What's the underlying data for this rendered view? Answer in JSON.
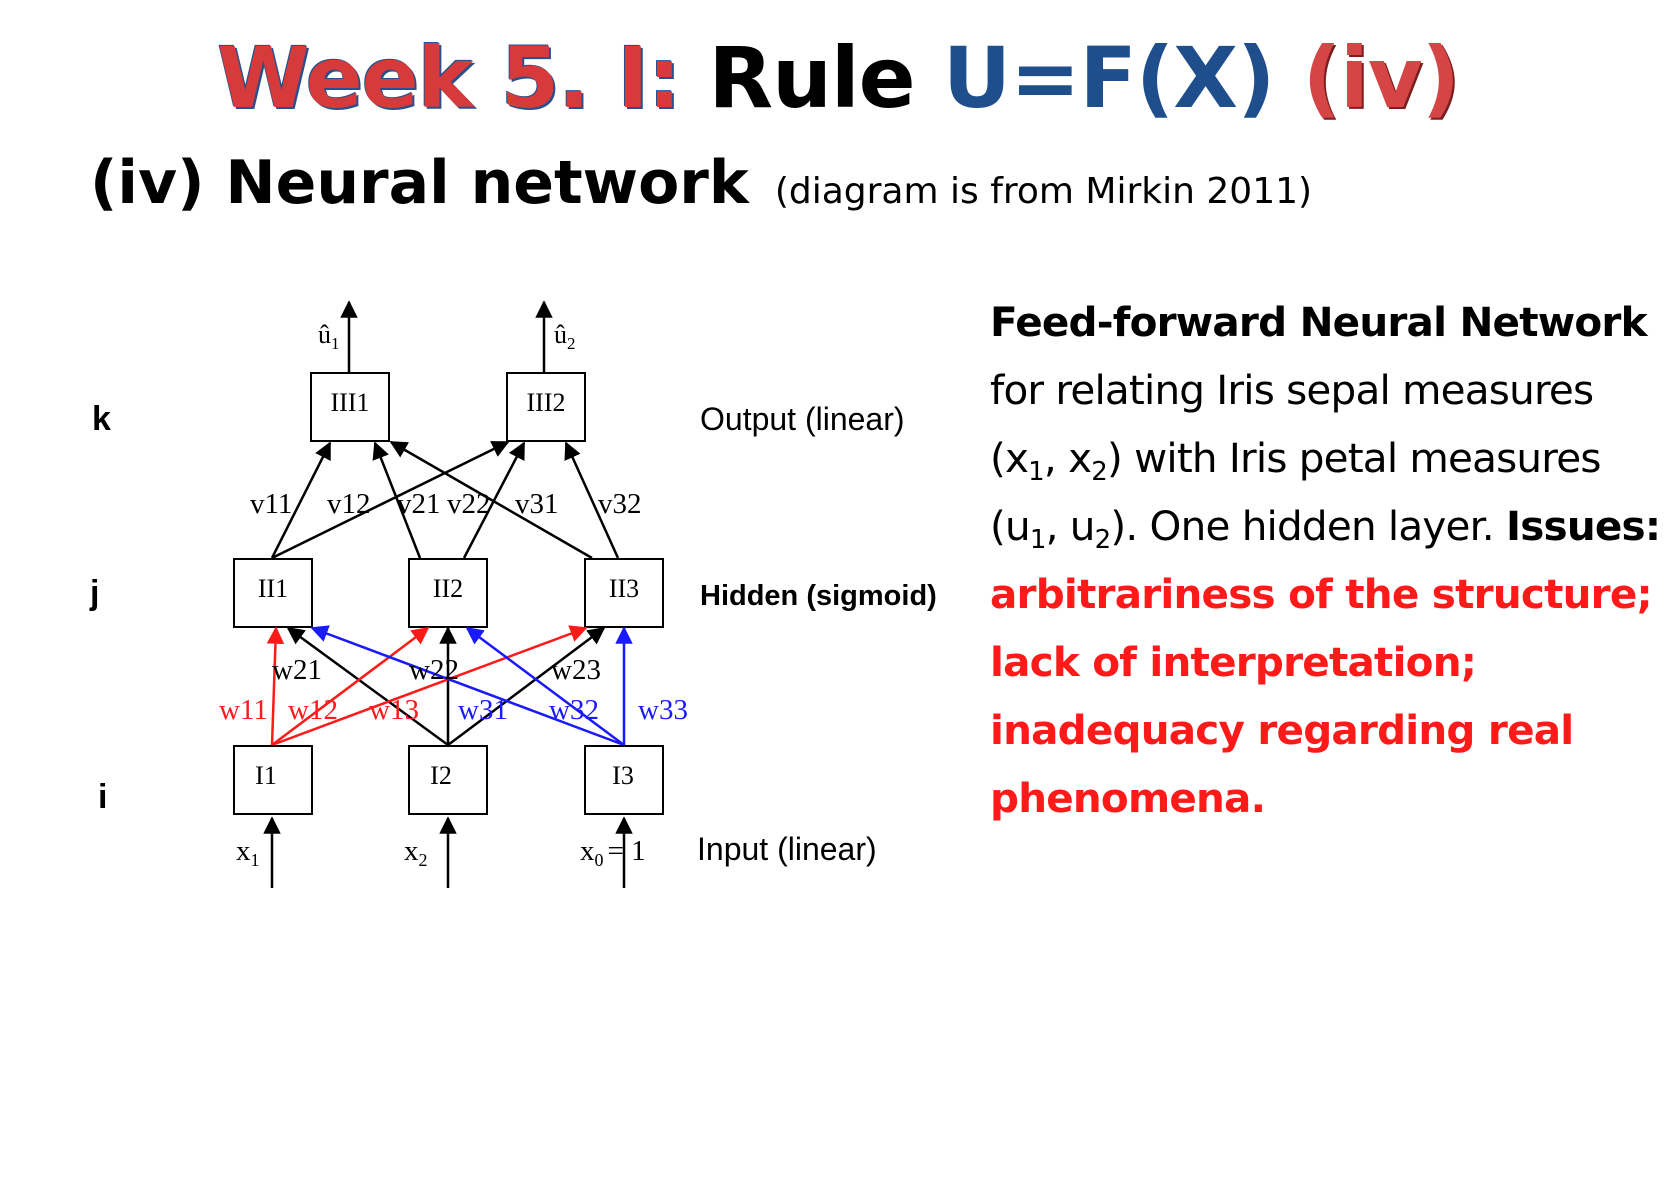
{
  "title": {
    "part1": "Week 5. I:",
    "part2": " Rule ",
    "part3": "U=F(X)",
    "part4": " (iv)"
  },
  "subtitle": {
    "main": "(iv) Neural network",
    "note": "(diagram is from Mirkin 2011)"
  },
  "diagram": {
    "rows": {
      "k": "k",
      "j": "j",
      "i": "i"
    },
    "layer_labels": {
      "output": "Output  (linear)",
      "hidden": "Hidden  (sigmoid)",
      "input": "Input  (linear)"
    },
    "nodes": {
      "III1": "III1",
      "III2": "III2",
      "II1": "II1",
      "II2": "II2",
      "II3": "II3",
      "I1": "I1",
      "I2": "I2",
      "I3": "I3"
    },
    "outputs": {
      "u1": "û",
      "u1_sub": "1",
      "u2": "û",
      "u2_sub": "2"
    },
    "inputs": {
      "x1": "x",
      "x1_sub": "1",
      "x2": "x",
      "x2_sub": "2",
      "x0": "x",
      "x0_sub": "0",
      "x0_val": "= 1"
    },
    "v_weights": [
      "v11",
      "v12",
      "v21",
      "v22",
      "v31",
      "v32"
    ],
    "w_weights_black": [
      "w21",
      "w22",
      "w23"
    ],
    "w_weights_red": [
      "w11",
      "w12",
      "w13"
    ],
    "w_weights_blue": [
      "w31",
      "w32",
      "w33"
    ],
    "colors": {
      "red": "#ff1a1a",
      "blue": "#1a1aff",
      "black": "#000000"
    }
  },
  "description": {
    "line1_bold": "Feed-forward Neural Network",
    "line1_rest": " for relating Iris sepal measures (x",
    "sub1": "1",
    "sep1": ", x",
    "sub2": "2",
    "part2": ") with Iris petal measures (u",
    "sub3": "1",
    "sep2": ", u",
    "sub4": "2",
    "part3": "). One hidden layer. ",
    "issues_label": "Issues:",
    "issues_text": "arbitrariness of the structure; lack of interpretation; inadequacy regarding real phenomena."
  }
}
